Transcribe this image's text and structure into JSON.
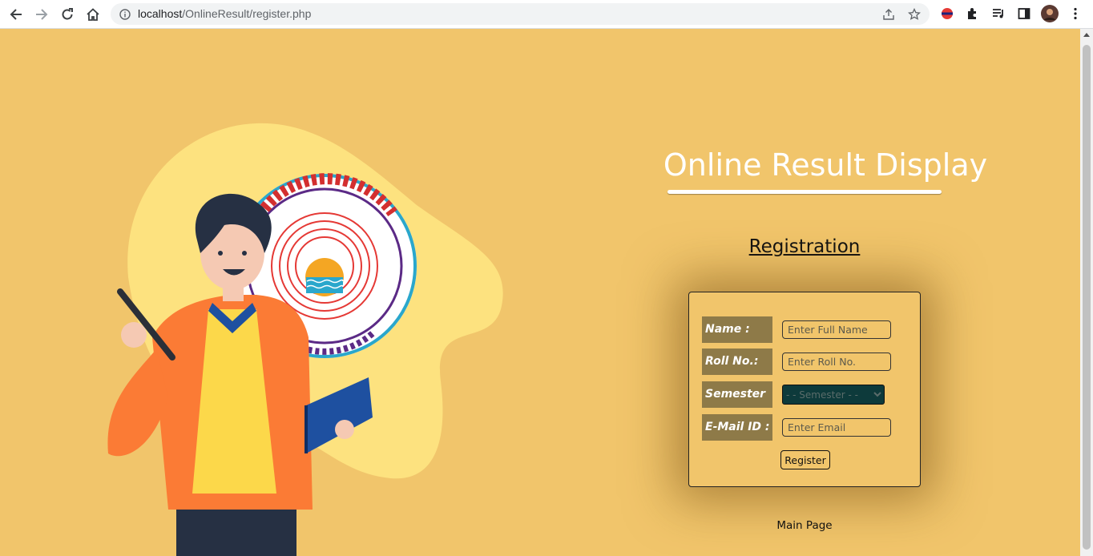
{
  "browser": {
    "url_host": "localhost",
    "url_path": "/OnlineResult/register.php"
  },
  "page": {
    "title": "Online Result Display",
    "subtitle": "Registration",
    "main_page_link": "Main Page"
  },
  "form": {
    "fields": [
      {
        "label": "Name :",
        "placeholder": "Enter Full Name"
      },
      {
        "label": "Roll No.:",
        "placeholder": "Enter Roll No."
      },
      {
        "label": "Semester :",
        "selected": "- - Semester - -"
      },
      {
        "label": "E-Mail ID :",
        "placeholder": "Enter Email"
      }
    ],
    "submit_label": "Register"
  },
  "colors": {
    "page_background": "#f1c56b",
    "label_background": "#8e7a48",
    "select_background": "#0d3a3b"
  },
  "icons": [
    "back-arrow-icon",
    "forward-arrow-icon",
    "reload-icon",
    "home-icon",
    "info-icon",
    "share-icon",
    "star-icon",
    "extension-icon",
    "puzzle-icon",
    "media-icon",
    "sidepanel-icon",
    "avatar",
    "kebab-menu-icon"
  ]
}
